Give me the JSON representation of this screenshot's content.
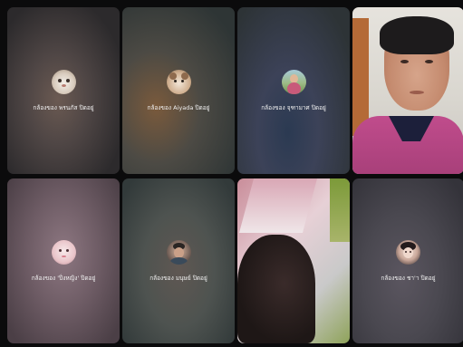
{
  "tiles": [
    {
      "type": "camera-off",
      "label": "กล้องของ พรนภัส ปิดอยู่",
      "avatar": "cat-avatar"
    },
    {
      "type": "camera-off",
      "label": "กล้องของ Aiyada ปิดอยู่",
      "avatar": "cat-avatar"
    },
    {
      "type": "camera-off",
      "label": "กล้องของ จุฑามาศ ปิดอยู่",
      "avatar": "person-avatar"
    },
    {
      "type": "video",
      "label": "",
      "avatar": ""
    },
    {
      "type": "camera-off",
      "label": "กล้องของ 'ปิ่งหญิง' ปิดอยู่",
      "avatar": "girl-avatar"
    },
    {
      "type": "camera-off",
      "label": "กล้องของ มนุษย์ ปิดอยู่",
      "avatar": "man-avatar"
    },
    {
      "type": "video",
      "label": "",
      "avatar": ""
    },
    {
      "type": "camera-off",
      "label": "กล้องของ ชา'า ปิดอยู่",
      "avatar": "kid-avatar"
    }
  ]
}
